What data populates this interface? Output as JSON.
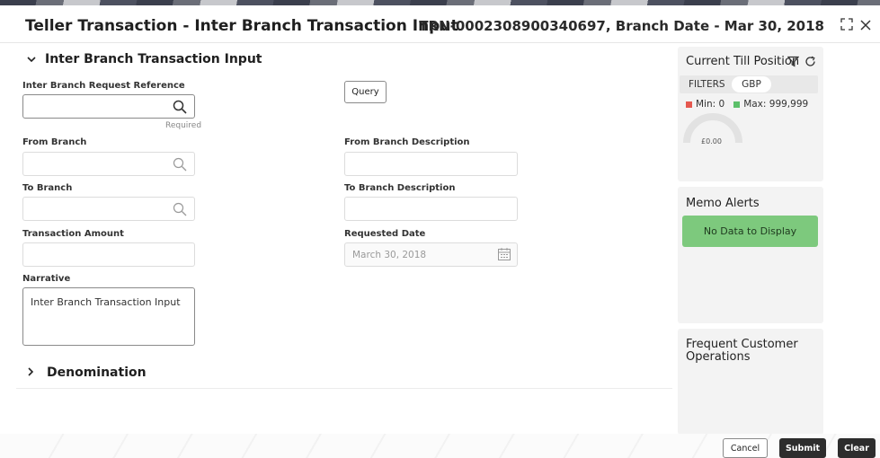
{
  "header": {
    "title": "Teller Transaction - Inter Branch Transaction Input",
    "reference": "TRN-0002308900340697, Branch Date - Mar 30, 2018"
  },
  "section": {
    "title": "Inter Branch Transaction Input"
  },
  "fields": {
    "request_ref_label": "Inter Branch Request Reference",
    "request_ref_required": "Required",
    "query_label": "Query",
    "from_branch_label": "From Branch",
    "from_branch_desc_label": "From Branch Description",
    "to_branch_label": "To Branch",
    "to_branch_desc_label": "To Branch Description",
    "amount_label": "Transaction Amount",
    "requested_date_label": "Requested Date",
    "requested_date_value": "March 30, 2018",
    "narrative_label": "Narrative",
    "narrative_value": "Inter Branch Transaction Input"
  },
  "denomination": {
    "title": "Denomination"
  },
  "till": {
    "title": "Current Till Position",
    "filters_label": "FILTERS",
    "currency": "GBP",
    "min_label": "Min: 0",
    "max_label": "Max: 999,999",
    "gauge_value": "£0.00",
    "colors": {
      "min": "#e5584f",
      "max": "#5cbf6a"
    }
  },
  "memo": {
    "title": "Memo Alerts",
    "empty": "No Data to Display"
  },
  "frequent": {
    "title": "Frequent Customer Operations"
  },
  "footer": {
    "cancel": "Cancel",
    "submit": "Submit",
    "clear": "Clear"
  }
}
